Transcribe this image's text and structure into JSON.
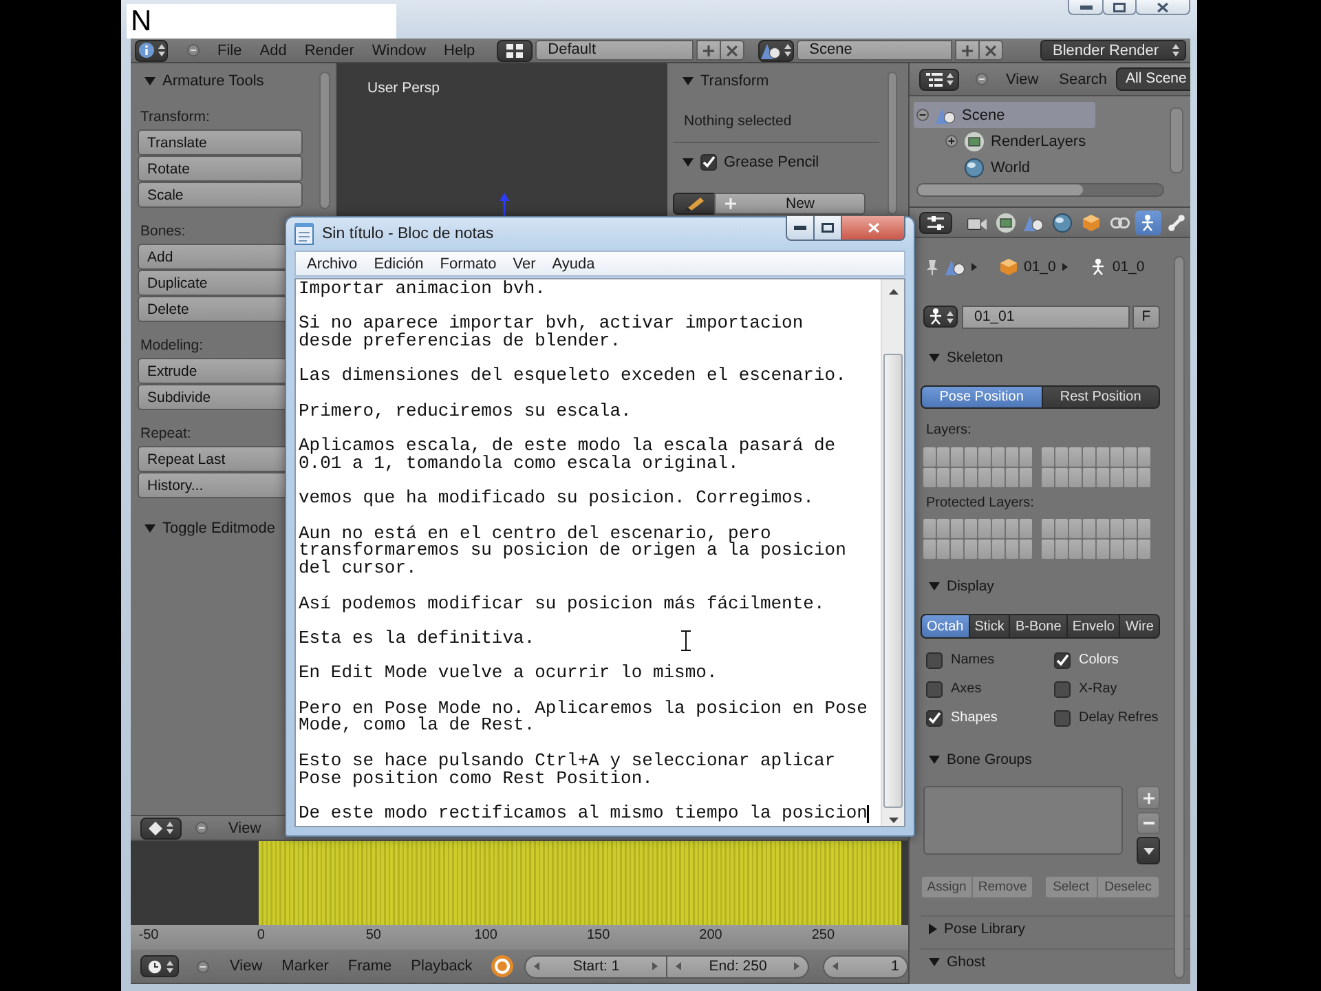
{
  "overlay_label": {
    "text": "N"
  },
  "header": {
    "menus": [
      "File",
      "Add",
      "Render",
      "Window",
      "Help"
    ],
    "screen_layout": "Default",
    "scene": "Scene",
    "render_engine": "Blender Render"
  },
  "tool_shelf": {
    "panels": [
      {
        "title": "Armature Tools",
        "expanded": true,
        "groups": [
          {
            "label": "Transform:",
            "buttons": [
              "Translate",
              "Rotate",
              "Scale"
            ]
          },
          {
            "label": "Bones:",
            "buttons": [
              "Add",
              "Duplicate",
              "Delete"
            ]
          },
          {
            "label": "Modeling:",
            "buttons": [
              "Extrude",
              "Subdivide"
            ]
          },
          {
            "label": "Repeat:",
            "buttons": [
              "Repeat Last",
              "History..."
            ]
          }
        ]
      },
      {
        "title": "Toggle Editmode",
        "expanded": true
      }
    ]
  },
  "viewport": {
    "label": "User Persp"
  },
  "sidebar": {
    "panels": [
      {
        "kind": "info",
        "title": "Transform",
        "expanded": true,
        "text": "Nothing selected"
      },
      {
        "kind": "grease_pencil",
        "title": "Grease Pencil",
        "expanded": true,
        "checked": true,
        "button": "New"
      }
    ]
  },
  "outliner": {
    "menus": [
      "View",
      "Search"
    ],
    "filter": "All Scene",
    "tree": [
      {
        "kind": "scene",
        "label": "Scene",
        "selected": true,
        "expanded": true,
        "children": [
          {
            "kind": "render_layers",
            "label": "RenderLayers",
            "selected": false,
            "expanded": false
          },
          {
            "kind": "world",
            "label": "World",
            "selected": false
          }
        ]
      }
    ]
  },
  "properties": {
    "tabs": [
      {
        "kind": "render",
        "selected": false
      },
      {
        "kind": "render_layers",
        "selected": false
      },
      {
        "kind": "scene",
        "selected": false
      },
      {
        "kind": "world",
        "selected": false
      },
      {
        "kind": "object",
        "selected": false
      },
      {
        "kind": "constraints",
        "selected": false
      },
      {
        "kind": "data",
        "selected": true
      },
      {
        "kind": "bone",
        "selected": false
      }
    ],
    "breadcrumb": [
      {
        "kind": "scene"
      },
      {
        "kind": "object",
        "label": "01_0"
      },
      {
        "kind": "armature",
        "label": "01_0"
      }
    ],
    "datablock": {
      "name": "01_01",
      "fake_user": "F"
    },
    "panels": [
      {
        "kind": "skeleton",
        "title": "Skeleton",
        "expanded": true,
        "modes": [
          {
            "label": "Pose Position",
            "selected": true
          },
          {
            "label": "Rest Position",
            "selected": false
          }
        ],
        "layers_label": "Layers:",
        "protected_label": "Protected Layers:"
      },
      {
        "kind": "display",
        "title": "Display",
        "expanded": true,
        "draw_types": [
          {
            "label": "Octah",
            "selected": true
          },
          {
            "label": "Stick",
            "selected": false
          },
          {
            "label": "B-Bone",
            "selected": false
          },
          {
            "label": "Envelo",
            "selected": false
          },
          {
            "label": "Wire",
            "selected": false
          }
        ],
        "options": [
          {
            "label": "Names",
            "checked": false
          },
          {
            "label": "Colors",
            "checked": true
          },
          {
            "label": "Axes",
            "checked": false
          },
          {
            "label": "X-Ray",
            "checked": false
          },
          {
            "label": "Shapes",
            "checked": true
          },
          {
            "label": "Delay Refres",
            "checked": false
          }
        ]
      },
      {
        "kind": "bone_groups",
        "title": "Bone Groups",
        "expanded": true,
        "actions": [
          {
            "label": "Assign",
            "disabled": true
          },
          {
            "label": "Remove",
            "disabled": true
          },
          {
            "label": "Select",
            "disabled": true
          },
          {
            "label": "Deselec",
            "disabled": true
          }
        ]
      },
      {
        "kind": "plain",
        "title": "Pose Library",
        "expanded": false
      },
      {
        "kind": "plain",
        "title": "Ghost",
        "expanded": true
      }
    ]
  },
  "dopesheet": {
    "menus": [
      "View"
    ],
    "ruler": [
      "-50",
      "0",
      "50",
      "100",
      "150",
      "200",
      "250"
    ]
  },
  "timeline": {
    "menus": [
      "View",
      "Marker",
      "Frame",
      "Playback"
    ],
    "start": "Start: 1",
    "end": "End: 250",
    "current": "1"
  },
  "notepad": {
    "title": "Sin título - Bloc de notas",
    "menus": [
      "Archivo",
      "Edición",
      "Formato",
      "Ver",
      "Ayuda"
    ],
    "paragraphs": [
      [
        "Importar animacion bvh."
      ],
      [
        "Si no aparece importar bvh, activar importacion",
        "desde preferencias de blender."
      ],
      [
        "Las dimensiones del esqueleto exceden el escenario."
      ],
      [
        "Primero, reduciremos su escala."
      ],
      [
        "Aplicamos escala, de este modo la escala pasará de",
        "0.01 a 1, tomandola como escala original."
      ],
      [
        "vemos que ha modificado su posicion. Corregimos."
      ],
      [
        "Aun no está en el centro del escenario, pero",
        "transformaremos su posicion de origen a la posicion",
        "del cursor."
      ],
      [
        "Así podemos modificar su posicion más fácilmente."
      ],
      [
        "Esta es la definitiva."
      ],
      [
        "En Edit Mode vuelve a ocurrir lo mismo."
      ],
      [
        "Pero en Pose Mode no. Aplicaremos la posicion en Pose",
        "Mode, como la de Rest."
      ],
      [
        "Esto se hace pulsando Ctrl+A y seleccionar aplicar",
        "Pose position como Rest Position."
      ],
      [
        "De este modo rectificamos al mismo tiempo la posicion"
      ]
    ]
  }
}
